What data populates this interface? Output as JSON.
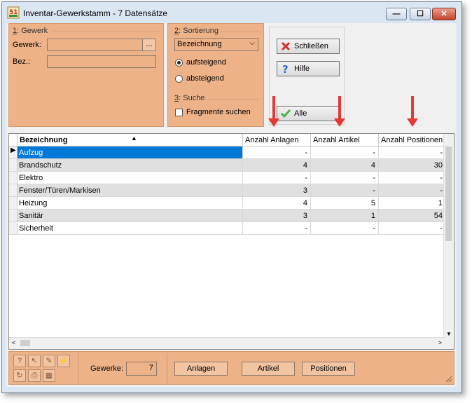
{
  "window": {
    "title": "Inventar-Gewerkstamm - 7 Datensätze",
    "min_glyph": "—",
    "max_glyph": "☐",
    "close_glyph": "✕"
  },
  "filter": {
    "group_num": "1",
    "group_rest": ": Gewerk",
    "gewerk_label": "Gewerk:",
    "gewerk_value": "",
    "browse_label": "...",
    "bez_label": "Bez.:",
    "bez_value": ""
  },
  "sort": {
    "group_num": "2",
    "group_rest": ": Sortierung",
    "combo_value": "Bezeichnung",
    "asc_label": "aufsteigend",
    "desc_label": "absteigend",
    "selected": "aufsteigend",
    "search_num": "3",
    "search_rest": ": Suche",
    "fragments_label": "Fragmente suchen"
  },
  "buttons": {
    "close_label": "Schließen",
    "help_label": "Hilfe",
    "all_label": "Alle"
  },
  "grid": {
    "columns": [
      "Bezeichnung",
      "Anzahl Anlagen",
      "Anzahl Artikel",
      "Anzahl Positionen"
    ],
    "rows": [
      {
        "name": "Aufzug",
        "anlagen": "-",
        "artikel": "-",
        "positionen": "-",
        "selected": true
      },
      {
        "name": "Brandschutz",
        "anlagen": "4",
        "artikel": "4",
        "positionen": "30"
      },
      {
        "name": "Elektro",
        "anlagen": "-",
        "artikel": "-",
        "positionen": "-"
      },
      {
        "name": "Fenster/Türen/Markisen",
        "anlagen": "3",
        "artikel": "-",
        "positionen": "-"
      },
      {
        "name": "Heizung",
        "anlagen": "4",
        "artikel": "5",
        "positionen": "1"
      },
      {
        "name": "Sanitär",
        "anlagen": "3",
        "artikel": "1",
        "positionen": "54"
      },
      {
        "name": "Sicherheit",
        "anlagen": "-",
        "artikel": "-",
        "positionen": "-"
      }
    ]
  },
  "footer": {
    "gewerke_label": "Gewerke:",
    "gewerke_count": "7",
    "anlagen_label": "Anlagen",
    "artikel_label": "Artikel",
    "positionen_label": "Positionen"
  },
  "colors": {
    "panel_orange": "#eeb288",
    "selection_blue": "#0078d7",
    "annotation_red": "#e53935"
  }
}
